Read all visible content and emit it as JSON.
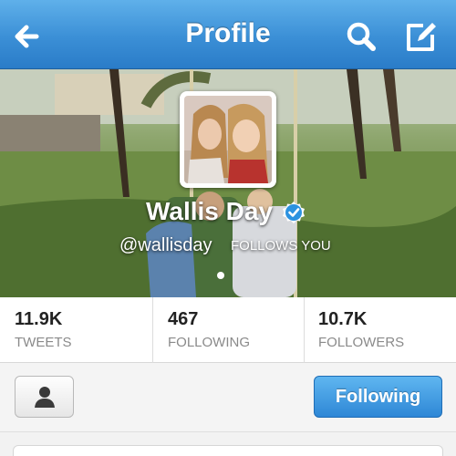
{
  "navbar": {
    "title": "Profile",
    "back_icon": "back-arrow-icon",
    "search_icon": "search-icon",
    "compose_icon": "compose-icon",
    "color": "#3b8fd6"
  },
  "profile": {
    "display_name": "Wallis Day",
    "handle": "@wallisday",
    "follows_you": "FOLLOWS YOU",
    "verified": true
  },
  "stats": [
    {
      "value": "11.9K",
      "label": "TWEETS"
    },
    {
      "value": "467",
      "label": "FOLLOWING"
    },
    {
      "value": "10.7K",
      "label": "FOLLOWERS"
    }
  ],
  "actions": {
    "person_icon": "person-icon",
    "following_label": "Following",
    "accent": "#2e87d6"
  }
}
